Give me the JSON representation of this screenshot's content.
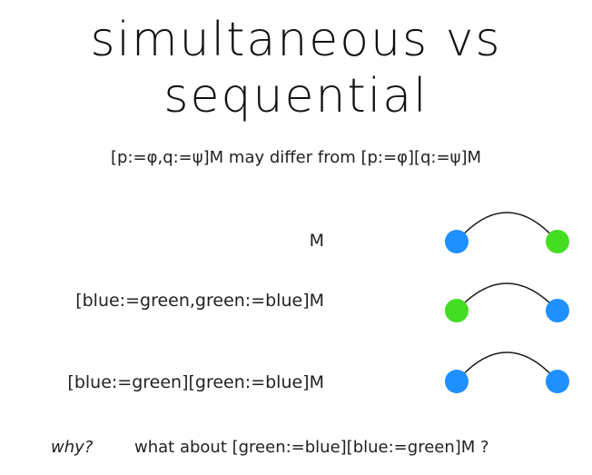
{
  "title_line1": "simultaneous vs",
  "title_line2": "sequential",
  "subtitle": "[p:=φ,q:=ψ]M  may differ from [p:=φ][q:=ψ]M",
  "rows": [
    {
      "label": "M",
      "left_color": "#1e90ff",
      "right_color": "#44dd22"
    },
    {
      "label": "[blue:=green,green:=blue]M",
      "left_color": "#44dd22",
      "right_color": "#1e90ff"
    },
    {
      "label": "[blue:=green][green:=blue]M",
      "left_color": "#1e90ff",
      "right_color": "#1e90ff"
    }
  ],
  "footer": {
    "why": "why?",
    "question": "what about [green:=blue][blue:=green]M ?"
  },
  "colors": {
    "blue": "#1e90ff",
    "green": "#44dd22",
    "edge": "#1a1a1a"
  }
}
